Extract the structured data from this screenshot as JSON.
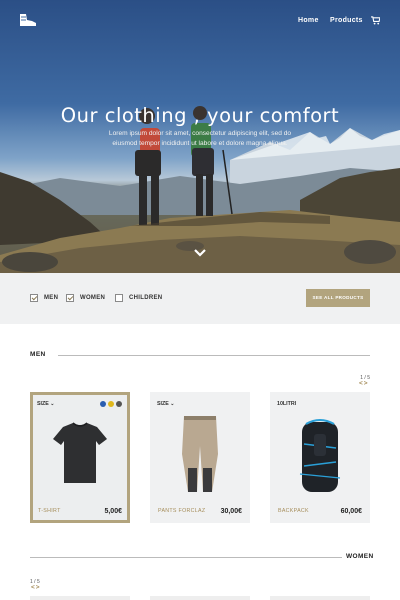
{
  "nav": {
    "logo_icon": "hiking-boot-icon",
    "links": [
      "Home",
      "Products"
    ],
    "cart_icon": "cart-icon"
  },
  "hero": {
    "title": "Our clothing , your comfort",
    "subtitle": "Lorem ipsum dolor sit amet, consectetur adipiscing elit, sed do eiusmod tempor incididunt ut labore et dolore magna aliqua.",
    "scroll_icon": "chevron-down-icon"
  },
  "filters": {
    "items": [
      {
        "label": "MEN",
        "checked": true
      },
      {
        "label": "WOMEN",
        "checked": true
      },
      {
        "label": "CHILDREN",
        "checked": false
      }
    ],
    "see_all_label": "SEE ALL PRODUCTS"
  },
  "sections": {
    "men": {
      "title": "MEN",
      "pager": "1 / 5",
      "arrows": "<>",
      "products": [
        {
          "top_label": "SIZE",
          "name": "T-SHIRT",
          "price": "5,00€",
          "selected": true,
          "swatches": [
            "#2a5db0",
            "#e0b81c",
            "#555555"
          ]
        },
        {
          "top_label": "SIZE",
          "name": "PANTS FORCLAZ",
          "price": "30,00€",
          "selected": false
        },
        {
          "top_label": "10LITRI",
          "name": "BACKPACK",
          "price": "60,00€",
          "selected": false
        }
      ]
    },
    "women": {
      "title": "WOMEN",
      "pager": "1 / 5",
      "arrows": "<>"
    }
  },
  "colors": {
    "accent": "#b2a47e",
    "accent_text": "#a58d5a",
    "filter_bg": "#f0f1f2"
  }
}
